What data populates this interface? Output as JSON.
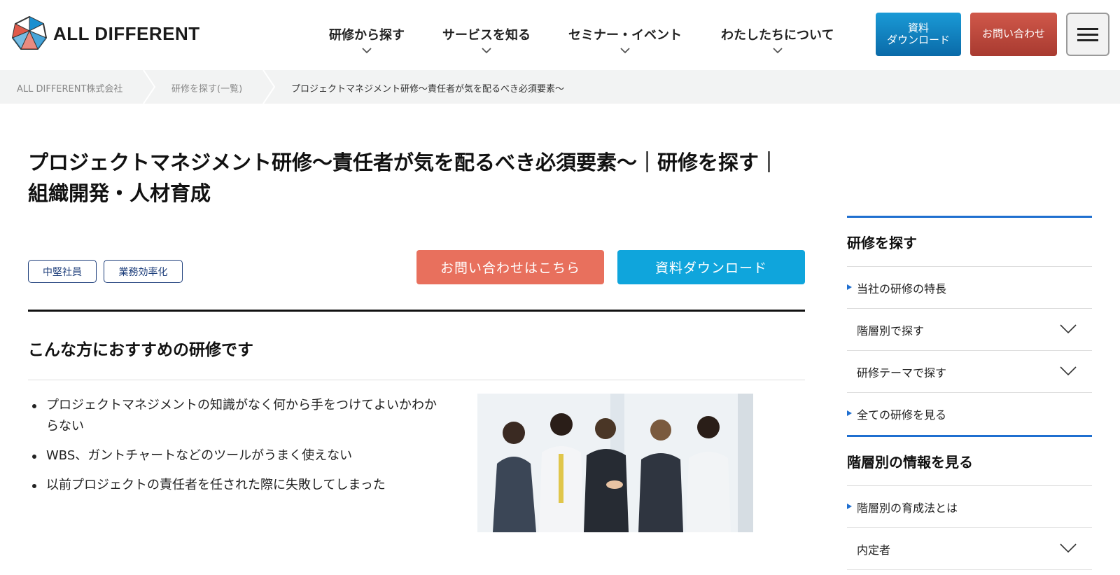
{
  "header": {
    "logo_text": "ALL DIFFERENT",
    "nav": [
      {
        "label": "研修から探す"
      },
      {
        "label": "サービスを知る"
      },
      {
        "label": "セミナー・イベント"
      },
      {
        "label": "わたしたちについて"
      }
    ],
    "doc_button_line1": "資料",
    "doc_button_line2": "ダウンロード",
    "contact_button": "お問い合わせ",
    "menu_icon": "hamburger-icon"
  },
  "breadcrumb": [
    "ALL DIFFERENT株式会社",
    "研修を探す(一覧)",
    "プロジェクトマネジメント研修～責任者が気を配るべき必須要素～"
  ],
  "page": {
    "title_line1": "プロジェクトマネジメント研修～責任者が気を配るべき必須要素～｜研修を探す｜",
    "title_line2": "組織開発・人材育成",
    "tags": [
      "中堅社員",
      "業務効率化"
    ],
    "cta_contact": "お問い合わせはこちら",
    "cta_download": "資料ダウンロード",
    "section_heading": "こんな方におすすめの研修です",
    "bullets": [
      "プロジェクトマネジメントの知識がなく何から手をつけてよいかわからない",
      "WBS、ガントチャートなどのツールがうまく使えない",
      "以前プロジェクトの責任者を任された際に失敗してしまった"
    ]
  },
  "sidebar": {
    "section1_heading": "研修を探す",
    "section1_items": [
      {
        "label": "当社の研修の特長",
        "type": "link"
      },
      {
        "label": "階層別で探す",
        "type": "toggle"
      },
      {
        "label": "研修テーマで探す",
        "type": "toggle"
      },
      {
        "label": "全ての研修を見る",
        "type": "link"
      }
    ],
    "section2_heading": "階層別の情報を見る",
    "section2_items": [
      {
        "label": "階層別の育成法とは",
        "type": "link"
      },
      {
        "label": "内定者",
        "type": "toggle"
      }
    ]
  },
  "colors": {
    "accent_blue": "#1f6fd0",
    "cta_orange": "#e8705d",
    "cta_cyan": "#0fa5dc",
    "tag_navy": "#1c3d7a"
  }
}
